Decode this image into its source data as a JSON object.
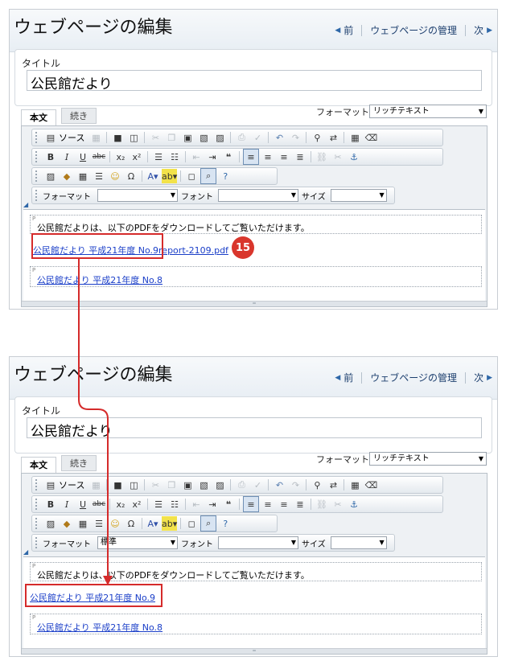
{
  "panels": [
    {
      "header": {
        "title": "ウェブページの編集",
        "nav_prev": "前",
        "nav_manage": "ウェブページの管理",
        "nav_next": "次"
      },
      "title_label": "タイトル",
      "title_value": "公民館だより",
      "tabs": {
        "body": "本文",
        "append": "続き"
      },
      "format_label": "フォーマット",
      "format_value": "リッチテキスト",
      "toolbar": {
        "source": "ソース",
        "format_label": "フォーマット",
        "format_value": "",
        "font_label": "フォント",
        "font_value": "",
        "size_label": "サイズ",
        "size_value": ""
      },
      "content": {
        "paragraph1": "公民館だよりは、以下のPDFをダウンロードしてご覧いただけます。",
        "link_selected": "公民館だより 平成21年度 No.9report-2109.pdf",
        "link_other": "公民館だより 平成21年度 No.8"
      },
      "badge": "15"
    },
    {
      "header": {
        "title": "ウェブページの編集",
        "nav_prev": "前",
        "nav_manage": "ウェブページの管理",
        "nav_next": "次"
      },
      "title_label": "タイトル",
      "title_value": "公民館だより",
      "tabs": {
        "body": "本文",
        "append": "続き"
      },
      "format_label": "フォーマット",
      "format_value": "リッチテキスト",
      "toolbar": {
        "source": "ソース",
        "format_label": "フォーマット",
        "format_value": "標準",
        "font_label": "フォント",
        "font_value": "",
        "size_label": "サイズ",
        "size_value": ""
      },
      "content": {
        "paragraph1": "公民館だよりは、以下のPDFをダウンロードしてご覧いただけます。",
        "link_selected": "公民館だより 平成21年度 No.9",
        "link_other": "公民館だより 平成21年度 No.8"
      }
    }
  ],
  "colors": {
    "accent_red": "#d52b2b",
    "link": "#1a3ec8",
    "badge": "#d9362c"
  },
  "icons": [
    "source-icon",
    "paste-icon",
    "save-icon",
    "preview-icon",
    "cut-icon",
    "copy-icon",
    "paste-text-icon",
    "paste-word-icon",
    "print-icon",
    "spellcheck-icon",
    "undo-icon",
    "redo-icon",
    "find-icon",
    "replace-icon",
    "select-all-icon",
    "remove-format-icon",
    "bold-icon",
    "italic-icon",
    "underline-icon",
    "strike-icon",
    "subscript-icon",
    "superscript-icon",
    "numbered-list-icon",
    "bulleted-list-icon",
    "outdent-icon",
    "indent-icon",
    "blockquote-icon",
    "align-left-icon",
    "align-center-icon",
    "align-right-icon",
    "justify-icon",
    "link-icon",
    "unlink-icon",
    "anchor-icon",
    "image-icon",
    "flash-icon",
    "table-icon",
    "hr-icon",
    "smiley-icon",
    "special-char-icon",
    "text-color-icon",
    "bg-color-icon",
    "maximize-icon",
    "show-blocks-icon",
    "about-icon"
  ]
}
